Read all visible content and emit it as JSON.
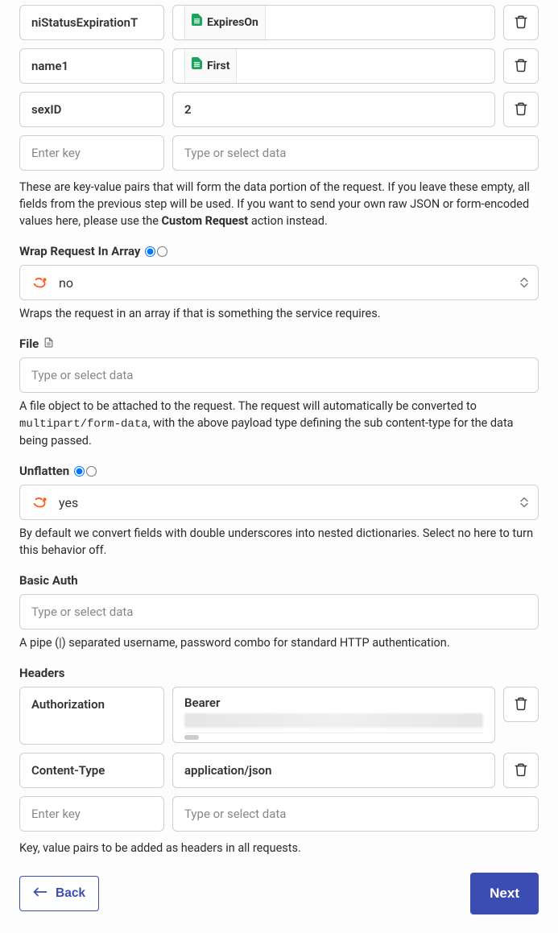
{
  "data_rows": [
    {
      "key": "niStatusExpirationT",
      "type": "chip",
      "chip": "ExpiresOn"
    },
    {
      "key": "name1",
      "type": "chip",
      "chip": "First"
    },
    {
      "key": "sexID",
      "type": "text",
      "value": "2"
    }
  ],
  "data_empty": {
    "key_placeholder": "Enter key",
    "value_placeholder": "Type or select data"
  },
  "data_help_1": "These are key-value pairs that will form the data portion of the request. If you leave these empty, all fields from the previous step will be used. If you want to send your own raw JSON or form-encoded values here, please use the ",
  "data_help_bold": "Custom Request",
  "data_help_2": " action instead.",
  "wrap": {
    "label": "Wrap Request In Array",
    "value": "no",
    "help": "Wraps the request in an array if that is something the service requires."
  },
  "file": {
    "label": "File",
    "placeholder": "Type or select data",
    "help_1": "A file object to be attached to the request. The request will automatically be converted to ",
    "help_mono": "multipart/form-data",
    "help_2": ", with the above payload type defining the sub content-type for the data being passed."
  },
  "unflatten": {
    "label": "Unflatten",
    "value": "yes",
    "help": "By default we convert fields with double underscores into nested dictionaries. Select no here to turn this behavior off."
  },
  "basic_auth": {
    "label": "Basic Auth",
    "placeholder": "Type or select data",
    "help": "A pipe (|) separated username, password combo for standard HTTP authentication."
  },
  "headers": {
    "label": "Headers",
    "rows": [
      {
        "key": "Authorization",
        "type": "multiline",
        "line1": "Bearer"
      },
      {
        "key": "Content-Type",
        "type": "text",
        "value": "application/json"
      }
    ],
    "empty_key_placeholder": "Enter key",
    "empty_value_placeholder": "Type or select data",
    "help": "Key, value pairs to be added as headers in all requests."
  },
  "footer": {
    "back": "Back",
    "next": "Next"
  }
}
